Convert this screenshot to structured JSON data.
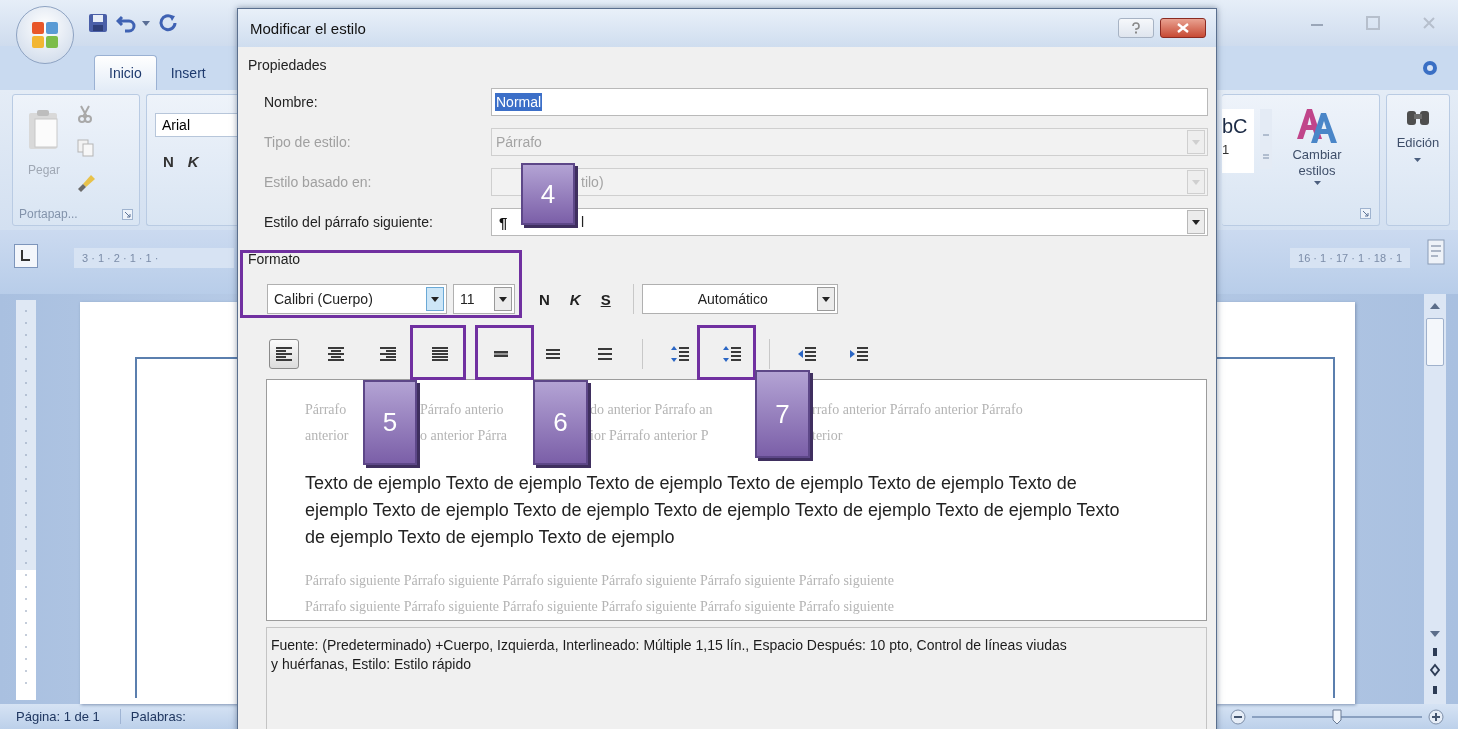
{
  "word": {
    "tabs": [
      {
        "label": "Inicio",
        "selected": true
      },
      {
        "label": "Insert",
        "selected": false
      }
    ],
    "clipboard": {
      "paste_label": "Pegar",
      "group_label": "Portapap..."
    },
    "font": {
      "name": "Arial",
      "bold": "N",
      "italic": "K"
    },
    "styles": {
      "gallery_text": "bC",
      "gallery_number": "1",
      "change_label": "Cambiar estilos",
      "edit_label": "Edición"
    },
    "ruler": {
      "left": "3 · 1 · 2 · 1 · 1 ·",
      "right": "16 · 1 · 17 · 1 · 18 · 1"
    },
    "status_bar": {
      "page": "Página: 1 de 1",
      "words": "Palabras:",
      "zoom": {
        "level": 0.5
      }
    }
  },
  "dialog": {
    "title": "Modificar el estilo",
    "properties": {
      "heading": "Propiedades",
      "fields": [
        {
          "kind": "text",
          "label": "Nombre:",
          "value": "Normal",
          "disabled": false,
          "value_selected": true
        },
        {
          "kind": "combo",
          "label": "Tipo de estilo:",
          "value": "Párrafo",
          "disabled": true,
          "value_selected": false
        },
        {
          "kind": "combo-covered",
          "label": "Estilo basado en:",
          "value": "tilo)",
          "disabled": true,
          "value_selected": false
        },
        {
          "kind": "combo-covered",
          "label": "Estilo del párrafo siguiente:",
          "mark": "¶",
          "value": "l",
          "disabled": false,
          "value_selected": false
        }
      ]
    },
    "format": {
      "heading": "Formato",
      "font": "Calibri (Cuerpo)",
      "size": "11",
      "bold": "N",
      "italic": "K",
      "underline": "S",
      "font_color_setting": "Automático",
      "tools": [
        {
          "kind": "align-left",
          "selected": true
        },
        {
          "kind": "align-center",
          "selected": false
        },
        {
          "kind": "align-right",
          "selected": false
        },
        {
          "kind": "justify",
          "selected": false
        },
        {
          "kind": "single-spacing",
          "selected": false
        },
        {
          "kind": "one-half-spacing",
          "selected": false
        },
        {
          "kind": "double-spacing",
          "selected": false
        },
        {
          "kind": "increase-paragraph-spacing",
          "selected": false
        },
        {
          "kind": "decrease-paragraph-spacing",
          "selected": false
        },
        {
          "kind": "decrease-indent",
          "selected": false
        },
        {
          "kind": "increase-indent",
          "selected": false
        }
      ]
    },
    "preview": {
      "before_lines": [
        [
          "Párrafo",
          "Párrafo anterio",
          "do anterior Párrafo an",
          "rrafo anterior Párrafo anterior Párrafo"
        ],
        [
          "anterior",
          "o anterior Párra",
          "ior Párrafo anterior P",
          "terior"
        ]
      ],
      "sample": "Texto de ejemplo Texto de ejemplo Texto de ejemplo Texto de ejemplo Texto de ejemplo Texto de ejemplo Texto de ejemplo Texto de ejemplo Texto de ejemplo Texto de ejemplo Texto de ejemplo Texto de ejemplo Texto de ejemplo Texto de ejemplo",
      "after_lines": [
        "Párrafo siguiente Párrafo siguiente Párrafo siguiente Párrafo siguiente Párrafo siguiente Párrafo siguiente",
        "Párrafo siguiente Párrafo siguiente Párrafo siguiente Párrafo siguiente Párrafo siguiente Párrafo siguiente"
      ]
    },
    "description": "Fuente: (Predeterminado) +Cuerpo, Izquierda, Interlineado:  Múltiple 1,15 lín., Espacio Después:  10 pto, Control de líneas viudas y huérfanas, Estilo: Estilo rápido"
  },
  "callouts": [
    {
      "label": "4"
    },
    {
      "label": "5"
    },
    {
      "label": "6"
    },
    {
      "label": "7"
    }
  ]
}
